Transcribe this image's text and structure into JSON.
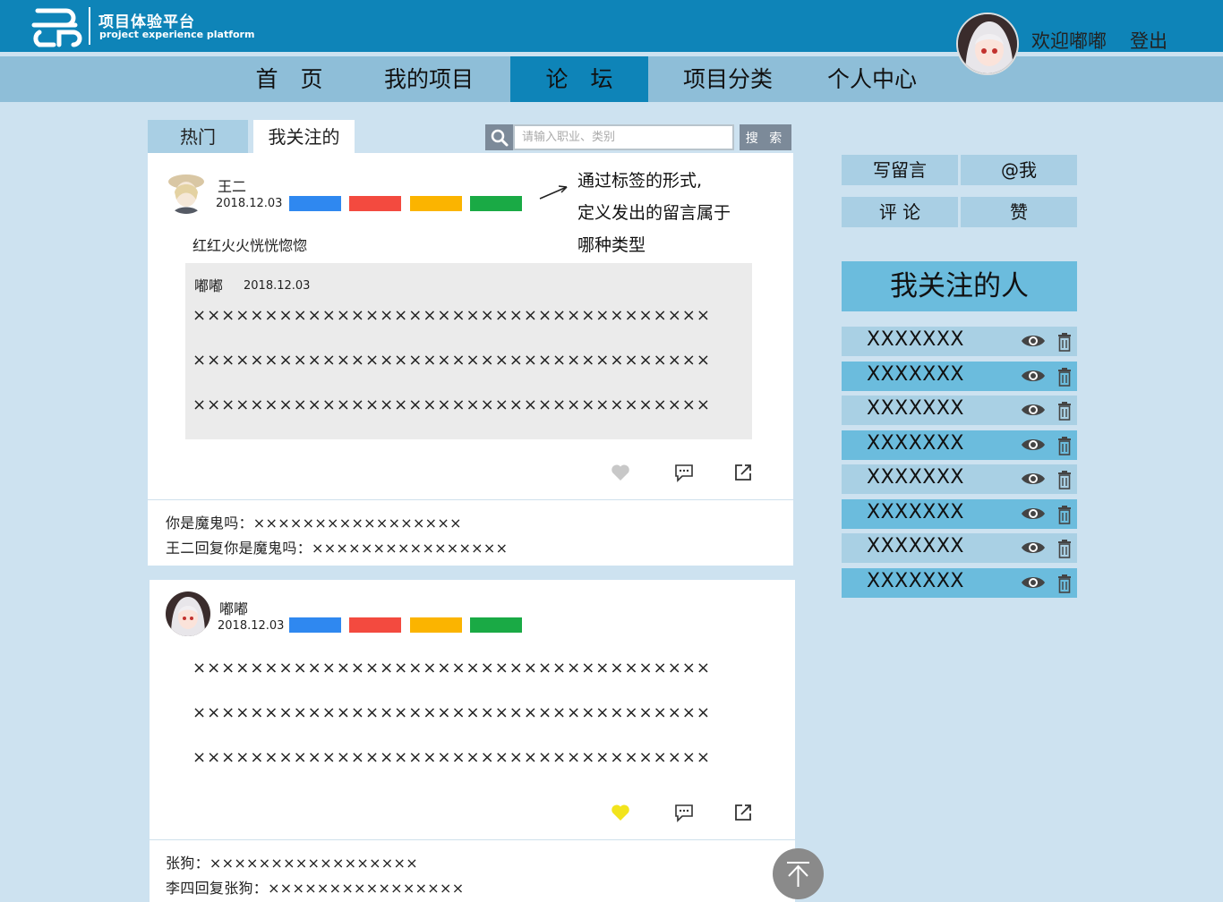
{
  "header": {
    "brand_title": "项目体验平台",
    "brand_sub": "project experience platform",
    "welcome": "欢迎嘟嘟",
    "logout": "登出"
  },
  "nav": [
    "首　页",
    "我的项目",
    "论　坛",
    "项目分类",
    "个人中心"
  ],
  "nav_active": "论　坛",
  "tabs": {
    "hot": "热门",
    "following": "我关注的"
  },
  "search": {
    "placeholder": "请输入职业、类别",
    "button": "搜 索"
  },
  "tag_colors": [
    "#2f88f0",
    "#f34a3f",
    "#fbb400",
    "#1aaa45"
  ],
  "annotation": [
    "通过标签的形式,",
    "定义发出的留言属于",
    "哪种类型"
  ],
  "posts": [
    {
      "author": "王二",
      "date": "2018.12.03",
      "text": "红红火火恍恍惚惚",
      "quote": {
        "author": "嘟嘟",
        "date": "2018.12.03",
        "lines": [
          "××××××××××××××××××××××××××××××××××××",
          "××××××××××××××××××××××××××××××××××××",
          "××××××××××××××××××××××××××××××××××××"
        ]
      },
      "liked": false,
      "comments": [
        "你是魔鬼吗：×××××××××××××××××",
        "王二回复你是魔鬼吗：××××××××××××××××"
      ]
    },
    {
      "author": "嘟嘟",
      "date": "2018.12.03",
      "lines": [
        "××××××××××××××××××××××××××××××××××××",
        "××××××××××××××××××××××××××××××××××××",
        "××××××××××××××××××××××××××××××××××××"
      ],
      "liked": true,
      "comments": [
        "张狗：×××××××××××××××××",
        "李四回复张狗：××××××××××××××××"
      ]
    }
  ],
  "sidebar": {
    "buttons": [
      "写留言",
      "@我",
      "评 论",
      "赞"
    ],
    "follow_title": "我关注的人",
    "following": [
      "XXXXXXX",
      "XXXXXXX",
      "XXXXXXX",
      "XXXXXXX",
      "XXXXXXX",
      "XXXXXXX",
      "XXXXXXX",
      "XXXXXXX"
    ]
  },
  "colors": {
    "header": "#0e84b8",
    "nav": "#8ebed8",
    "page_bg": "#cde2f0",
    "like_active": "#f2e41c",
    "like_inactive": "#c8c8c8"
  }
}
